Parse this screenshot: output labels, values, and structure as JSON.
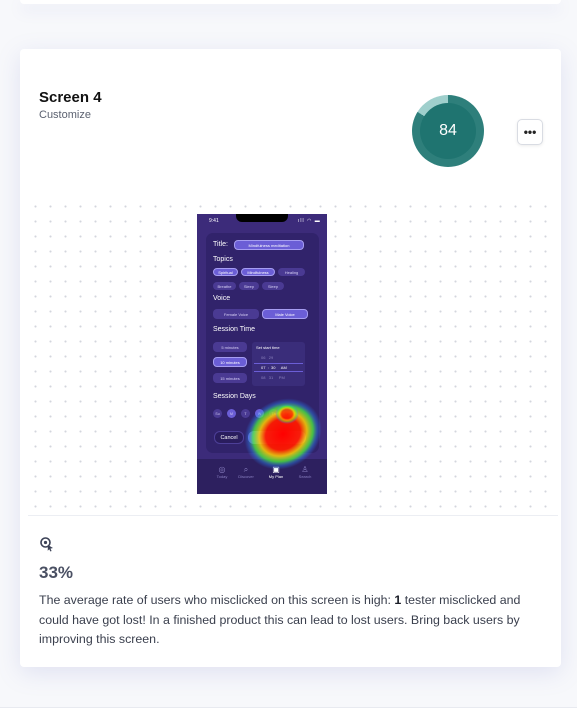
{
  "screen": {
    "title": "Screen 4",
    "subtitle": "Customize",
    "score": "84",
    "score_fraction": 0.84
  },
  "phone": {
    "status_time": "9:41",
    "title_label": "Title:",
    "title_value": "Mindfulness meditation",
    "topics_label": "Topics",
    "topics": [
      "Spiritual",
      "Mindfulness",
      "Healing",
      "Breathe",
      "Sleep",
      "Sleep"
    ],
    "voice_label": "Voice",
    "voices": [
      "Female Voice",
      "Male Voice"
    ],
    "session_time_label": "Session Time",
    "durations": [
      "5 minutes",
      "10 minutes",
      "15 minutes"
    ],
    "start_time_label": "Set start time",
    "time_rows": [
      "06   29",
      "07  :  30     AM",
      "08   31     PM"
    ],
    "session_days_label": "Session Days",
    "days": [
      "Su",
      "M",
      "T",
      "W",
      "Th",
      "F"
    ],
    "cancel_label": "Cancel",
    "tabs": [
      "Today",
      "Discover",
      "My Plan",
      "Search"
    ]
  },
  "misclick": {
    "percent": "33%",
    "text_before": "The average rate of users who misclicked on this screen is high: ",
    "count": "1",
    "text_after": " tester misclicked and could have got lost! In a finished product this can lead to lost users. Bring back users by improving this screen."
  }
}
